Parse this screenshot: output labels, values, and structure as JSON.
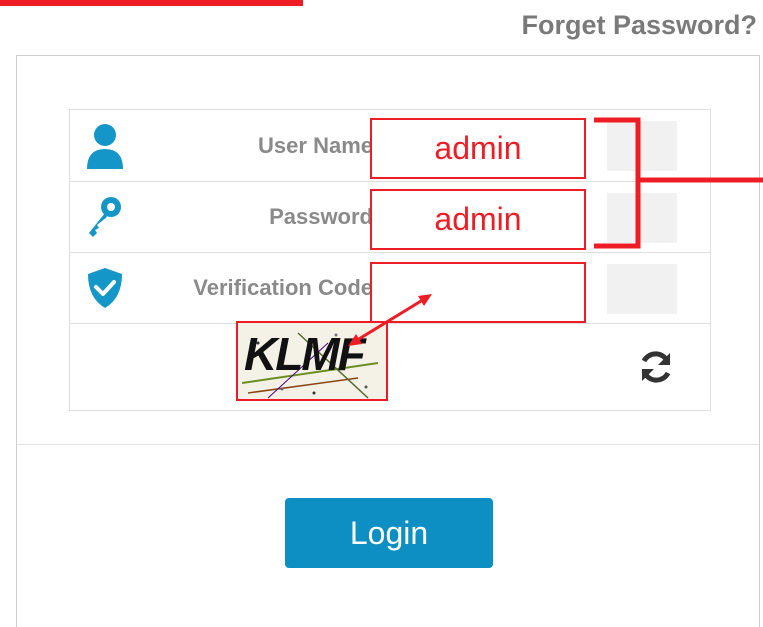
{
  "header": {
    "forget_password": "Forget Password?"
  },
  "form": {
    "username_label": "User Name",
    "password_label": "Password",
    "verification_label": "Verification Code",
    "username_value": "admin",
    "password_value": "admin",
    "verification_value": ""
  },
  "captcha": {
    "text": "KLMF"
  },
  "login_button": "Login",
  "icons": {
    "user": "user-icon",
    "key": "key-icon",
    "shield": "shield-check-icon",
    "refresh": "refresh-icon"
  },
  "colors": {
    "accent": "#0d8fc3",
    "annotation": "#ee1c25",
    "label": "#8a8a8a"
  }
}
